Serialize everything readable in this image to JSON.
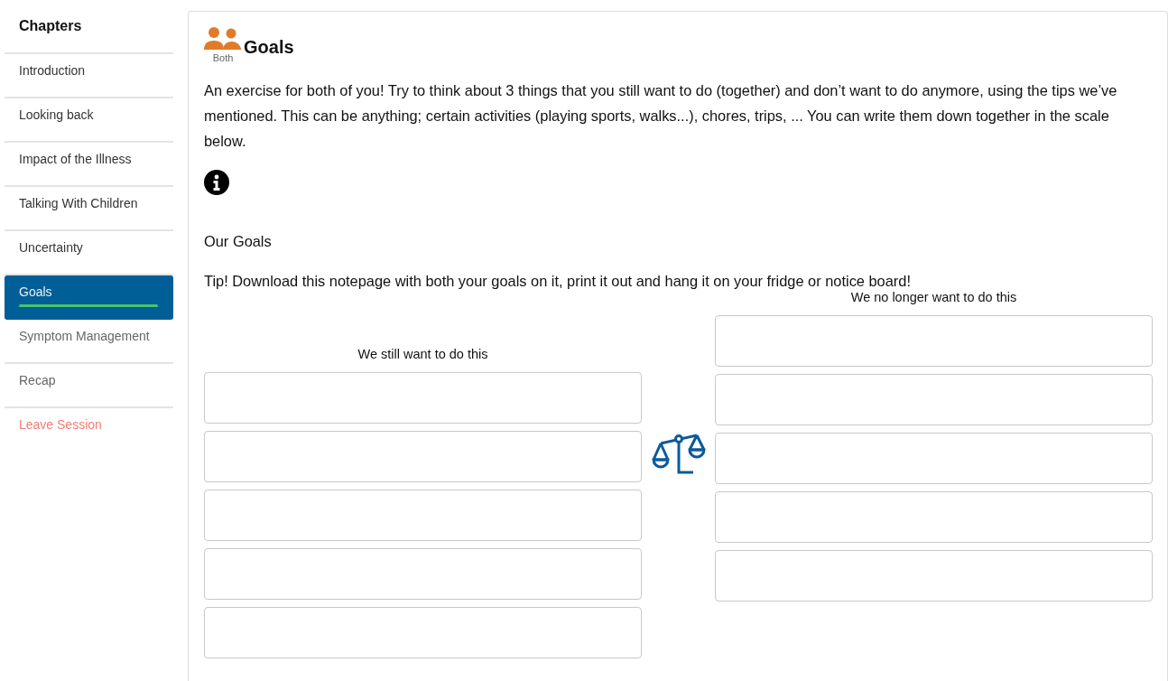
{
  "sidebar": {
    "title": "Chapters",
    "items": [
      {
        "label": "Introduction",
        "selected": false,
        "visited": true
      },
      {
        "label": "Looking back",
        "selected": false,
        "visited": true
      },
      {
        "label": "Impact of the Illness",
        "selected": false,
        "visited": true
      },
      {
        "label": "Talking With Children",
        "selected": false,
        "visited": true
      },
      {
        "label": "Uncertainty",
        "selected": false,
        "visited": true
      },
      {
        "label": "Goals",
        "selected": true,
        "visited": true
      },
      {
        "label": "Symptom Management",
        "selected": false,
        "visited": false
      },
      {
        "label": "Recap",
        "selected": false,
        "visited": false
      }
    ],
    "leave": "Leave Session"
  },
  "page": {
    "title": "Goals",
    "audience": "Both",
    "intro": "An exercise for both of you! Try to think about 3 things that you still want to do (together) and don’t want to do anymore, using the tips we’ve mentioned. This can be anything; certain activities (playing sports, walks...), chores, trips, ... You can write them down together in the scale below.",
    "section_title": "Our Goals",
    "tip": "Tip! Download this notepage with both your goals on it, print it out and hang it on your fridge or notice board!",
    "columns": [
      {
        "heading": "We still want to do this",
        "boxes": [
          {
            "kind": "text"
          },
          {
            "kind": "text"
          },
          {
            "kind": "text"
          },
          {
            "kind": "text"
          },
          {
            "kind": "text"
          }
        ]
      },
      {
        "heading": "We no longer want to do this",
        "boxes": [
          {
            "kind": "text"
          },
          {
            "kind": "text"
          },
          {
            "kind": "text"
          },
          {
            "kind": "text"
          },
          {
            "kind": "text"
          }
        ]
      }
    ]
  }
}
